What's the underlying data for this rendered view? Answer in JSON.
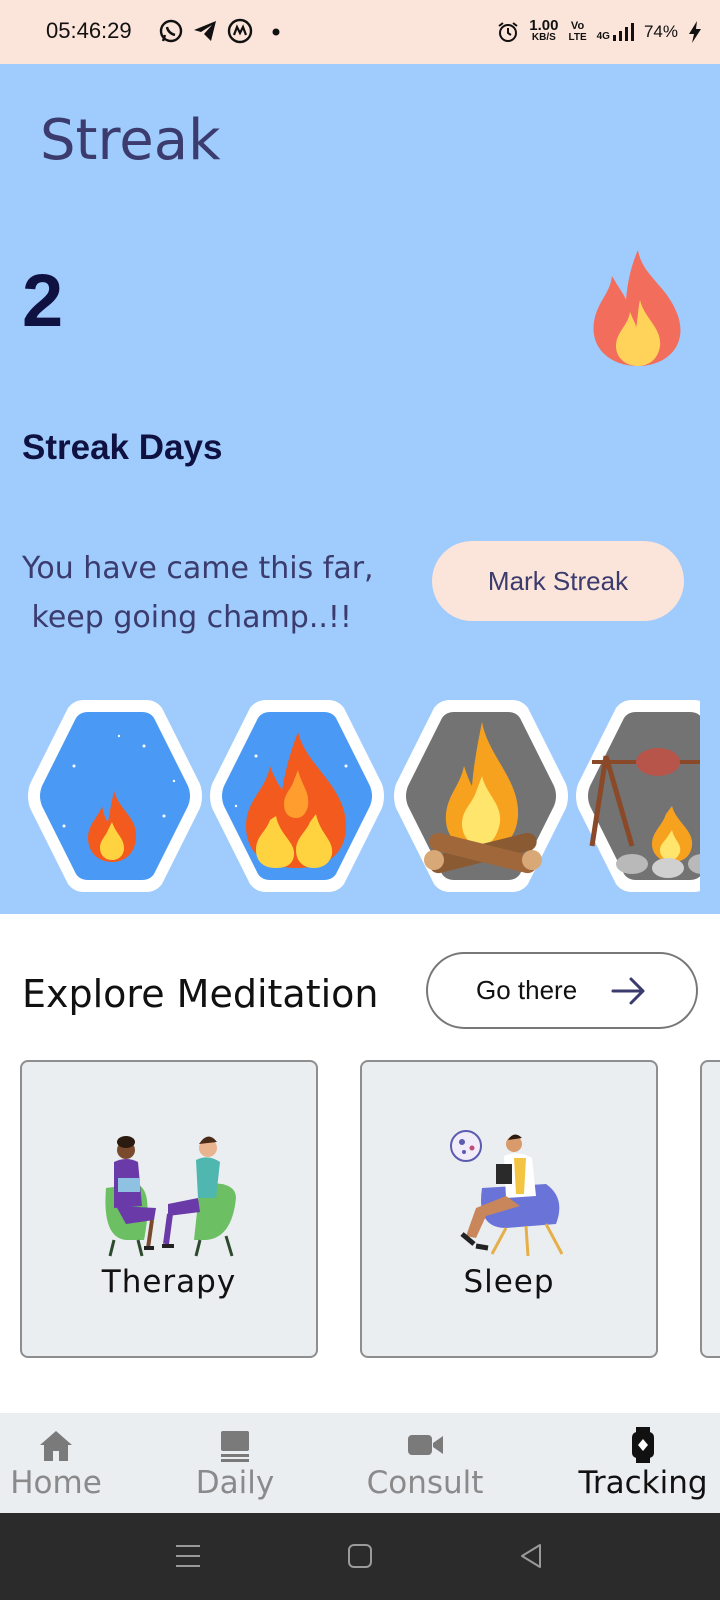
{
  "status_bar": {
    "time": "05:46:29",
    "net_speed_value": "1.00",
    "net_speed_unit": "KB/S",
    "volte_top": "Vo",
    "volte_bottom": "LTE",
    "network": "4G",
    "battery": "74%",
    "icons": [
      "whatsapp-icon",
      "telegram-icon",
      "coin-app-icon",
      "dot-icon",
      "alarm-icon",
      "signal-icon",
      "charging-icon"
    ]
  },
  "streak": {
    "title": "Streak",
    "count": "2",
    "label": "Streak Days",
    "motivation": "You have came this far,\n keep going champ..!!",
    "mark_button": "Mark Streak",
    "badges": [
      {
        "name": "small-flame",
        "unlocked": true
      },
      {
        "name": "big-flame",
        "unlocked": true
      },
      {
        "name": "campfire",
        "unlocked": false
      },
      {
        "name": "roast-fire",
        "unlocked": false
      }
    ]
  },
  "explore": {
    "title": "Explore Meditation",
    "go_button": "Go there",
    "cards": [
      {
        "label": "Therapy"
      },
      {
        "label": "Sleep"
      }
    ]
  },
  "bottom_nav": {
    "items": [
      {
        "label": "Home",
        "icon": "home-icon",
        "active": false
      },
      {
        "label": "Daily",
        "icon": "daily-icon",
        "active": false
      },
      {
        "label": "Consult",
        "icon": "video-camera-icon",
        "active": false
      },
      {
        "label": "Tracking",
        "icon": "smartwatch-icon",
        "active": true
      }
    ]
  },
  "colors": {
    "status_bar_bg": "#fbe4da",
    "panel_bg": "#9fcbfd",
    "title_color": "#3b3b6e",
    "dark_navy": "#0f1140",
    "button_bg": "#fbe4da",
    "card_bg": "#ebeef1",
    "nav_bg": "#ebeef1",
    "system_nav_bg": "#2b2b2b"
  }
}
